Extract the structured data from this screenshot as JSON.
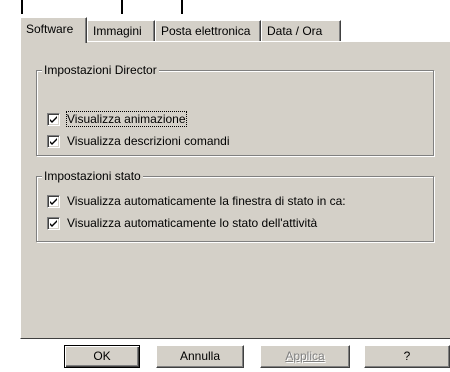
{
  "tabs": [
    {
      "label": "Software",
      "active": true
    },
    {
      "label": "Immagini",
      "active": false
    },
    {
      "label": "Posta elettronica",
      "active": false
    },
    {
      "label": "Data / Ora",
      "active": false
    }
  ],
  "director_group": {
    "title": "Impostazioni Director",
    "options": [
      {
        "label": "Visualizza animazione",
        "checked": true
      },
      {
        "label": "Visualizza descrizioni comandi",
        "checked": true
      }
    ]
  },
  "stato_group": {
    "title": "Impostazioni stato",
    "options": [
      {
        "label": "Visualizza automaticamente la finestra di stato in ca:",
        "checked": true
      },
      {
        "label": "Visualizza automaticamente lo stato dell'attività",
        "checked": true
      }
    ]
  },
  "buttons": {
    "ok": "OK",
    "cancel": "Annulla",
    "apply": "Applica",
    "help": "?"
  },
  "colors": {
    "face": "#d4d0c8",
    "shadow": "#808080",
    "highlight": "#ffffff"
  }
}
